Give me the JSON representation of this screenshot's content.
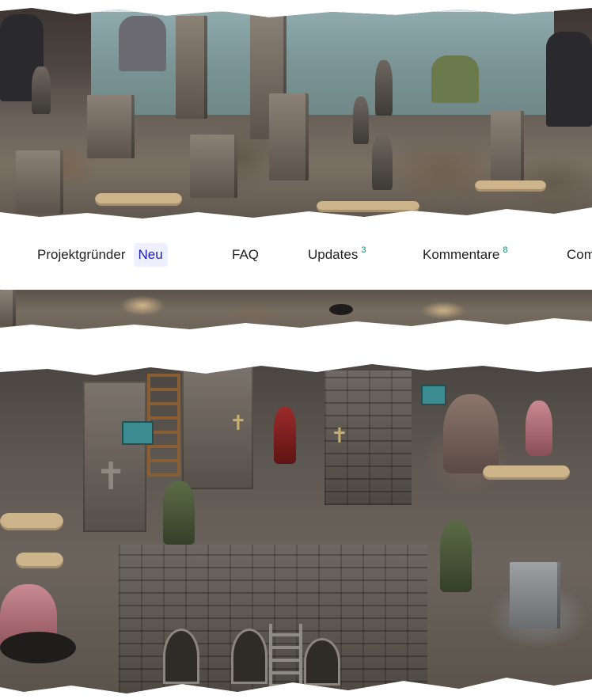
{
  "tabs": [
    {
      "label": "Projektgründer",
      "badge": "Neu"
    },
    {
      "label": "FAQ"
    },
    {
      "label": "Updates",
      "count": "3"
    },
    {
      "label": "Kommentare",
      "count": "8"
    },
    {
      "label": "Com"
    }
  ],
  "colors": {
    "count_green": "#0a8f5b",
    "badge_bg": "#eef0ff",
    "badge_text": "#1d1fb3",
    "text": "#1f1f1f"
  }
}
